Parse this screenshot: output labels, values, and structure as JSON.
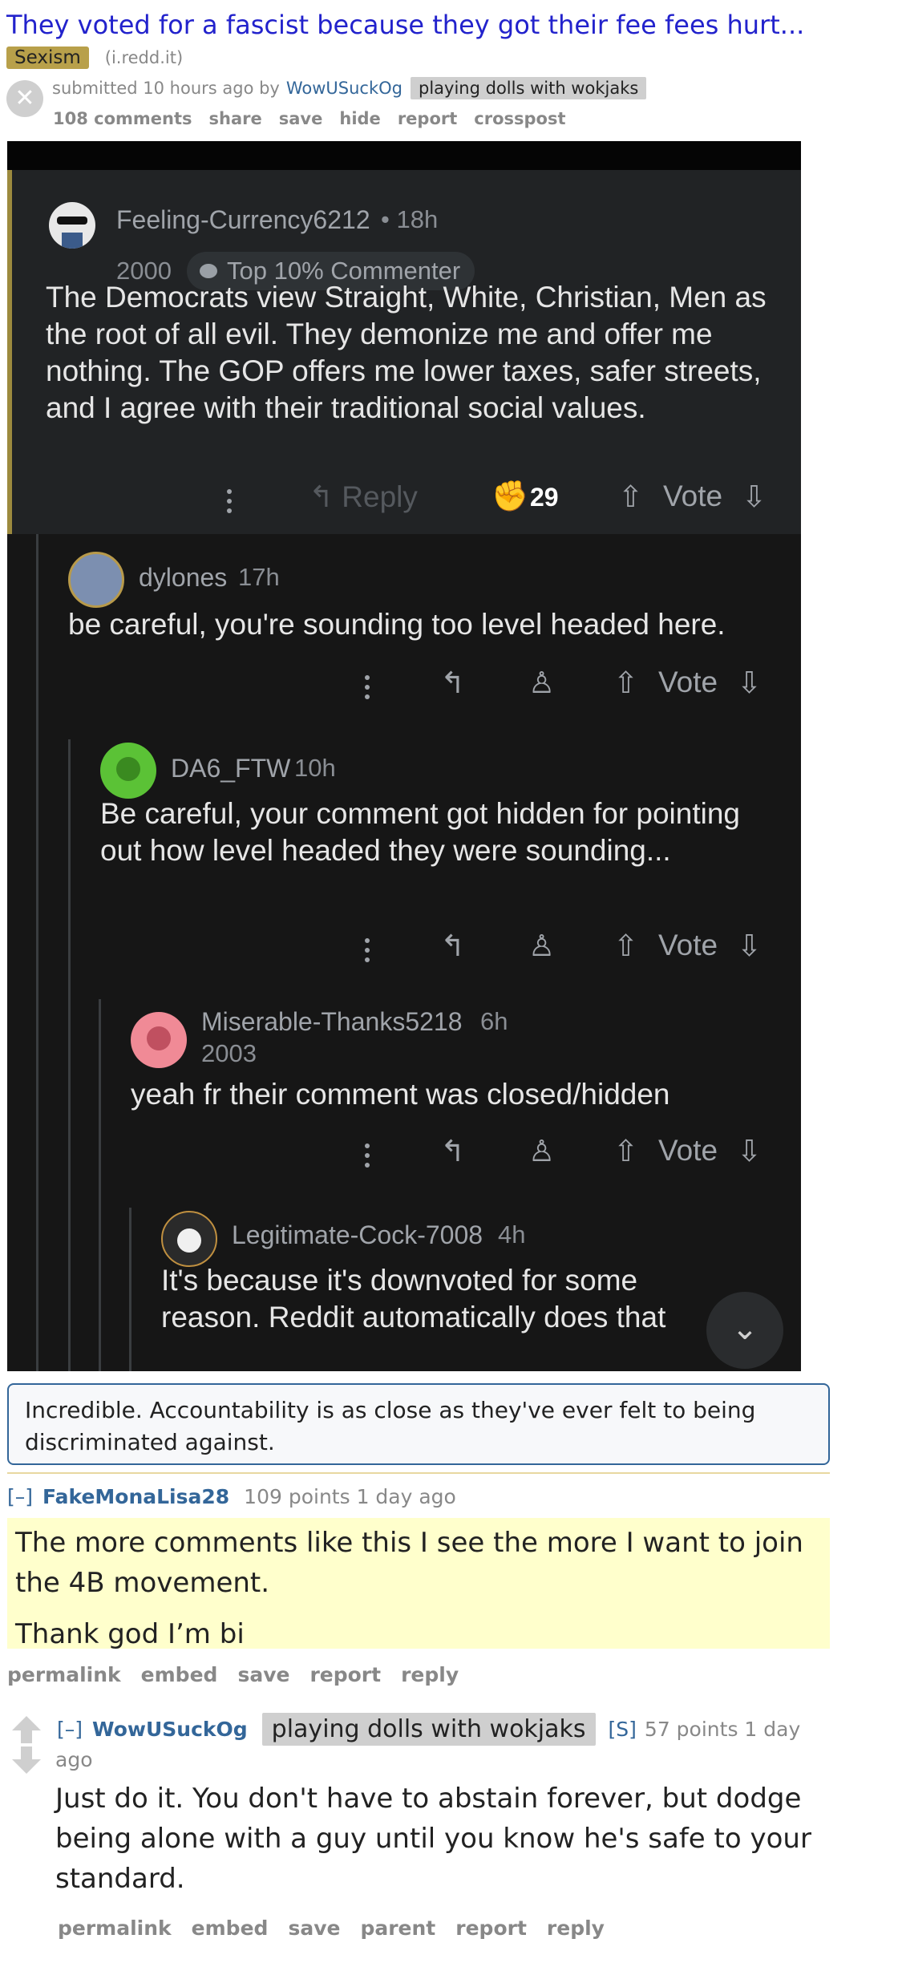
{
  "post": {
    "title": "They voted for a fascist because they got their fee fees hurt...",
    "flair": "Sexism",
    "domain": "(i.redd.it)",
    "submitted_prefix": "submitted 10 hours ago by",
    "author": "WowUSuckOg",
    "author_flair": "playing dolls with wokjaks",
    "buttons": [
      "108 comments",
      "share",
      "save",
      "hide",
      "report",
      "crosspost"
    ]
  },
  "image": {
    "top_comment": {
      "user": "Feeling-Currency6212",
      "time": "• 18h",
      "year": "2000",
      "badge": "Top 10% Commenter",
      "text": "The Democrats view Straight, White, Christian, Men as the root of all evil. They demonize me and offer me nothing. The GOP offers me lower taxes, safer streets, and I agree with their traditional social values.",
      "reply": "Reply",
      "award_count": "29",
      "vote": "Vote"
    },
    "replies": [
      {
        "user": "dylones",
        "time": "17h",
        "year": "",
        "text": "be careful, you're sounding too level headed here.",
        "vote": "Vote"
      },
      {
        "user": "DA6_FTW",
        "time": "10h",
        "year": "",
        "text": "Be careful, your comment got hidden for pointing out how level headed they were sounding...",
        "vote": "Vote"
      },
      {
        "user": "Miserable-Thanks5218",
        "time": "6h",
        "year": "2003",
        "text": "yeah fr their comment was closed/hidden",
        "vote": "Vote"
      },
      {
        "user": "Legitimate-Cock-7008",
        "time": "4h",
        "year": "",
        "text": "It's because it's downvoted for some reason. Reddit automatically does that",
        "vote": ""
      }
    ]
  },
  "caption": "Incredible. Accountability is as close as they've ever felt to being discriminated against.",
  "comments": [
    {
      "toggle": "[–]",
      "author": "FakeMonaLisa28",
      "meta": "109 points 1 day ago",
      "paragraphs": [
        "The more comments like this I see the more I want to join the 4B movement.",
        "Thank god I’m bi"
      ],
      "buttons": [
        "permalink",
        "embed",
        "save",
        "report",
        "reply"
      ]
    },
    {
      "toggle": "[–]",
      "author": "WowUSuckOg",
      "flair": "playing dolls with wokjaks",
      "submitter": "[S]",
      "meta": "57 points 1 day",
      "meta2": "ago",
      "text": "Just do it. You don't have to abstain forever, but dodge being alone with a guy until you know he's safe to your standard.",
      "buttons": [
        "permalink",
        "embed",
        "save",
        "parent",
        "report",
        "reply"
      ]
    }
  ]
}
